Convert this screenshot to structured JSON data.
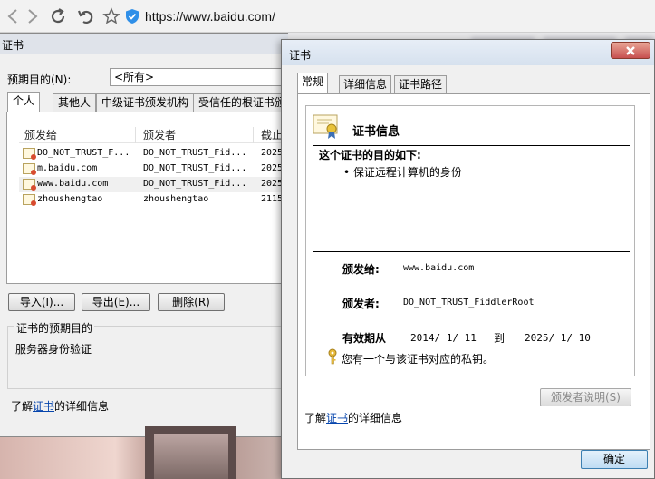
{
  "browser": {
    "url": "https://www.baidu.com/"
  },
  "back_dialog": {
    "title": "证书",
    "purpose_label": "预期目的(N):",
    "purpose_value": "<所有>",
    "tabs": [
      "个人",
      "其他人",
      "中级证书颁发机构",
      "受信任的根证书颁"
    ],
    "columns": [
      "颁发给",
      "颁发者",
      "截止"
    ],
    "rows": [
      {
        "issued_to": "DO_NOT_TRUST_F...",
        "issued_by": "DO_NOT_TRUST_Fid...",
        "expires": "2025"
      },
      {
        "issued_to": "m.baidu.com",
        "issued_by": "DO_NOT_TRUST_Fid...",
        "expires": "2025"
      },
      {
        "issued_to": "www.baidu.com",
        "issued_by": "DO_NOT_TRUST_Fid...",
        "expires": "2025"
      },
      {
        "issued_to": "zhoushengtao",
        "issued_by": "zhoushengtao",
        "expires": "2115"
      }
    ],
    "buttons": {
      "import": "导入(I)...",
      "export": "导出(E)...",
      "remove": "删除(R)"
    },
    "group_title": "证书的预期目的",
    "group_value": "服务器身份验证",
    "learn_prefix": "了解",
    "learn_link": "证书",
    "learn_suffix": "的详细信息"
  },
  "front_dialog": {
    "title": "证书",
    "tabs": [
      "常规",
      "详细信息",
      "证书路径"
    ],
    "info_title": "证书信息",
    "purpose_heading": "这个证书的目的如下:",
    "purpose_item": "• 保证远程计算机的身份",
    "issued_to_label": "颁发给:",
    "issued_to_value": "www.baidu.com",
    "issued_by_label": "颁发者:",
    "issued_by_value": "DO_NOT_TRUST_FiddlerRoot",
    "valid_label": "有效期从",
    "valid_from": "2014/ 1/ 11",
    "valid_to_word": "到",
    "valid_to": "2025/ 1/ 10",
    "key_note": "您有一个与该证书对应的私钥。",
    "issuer_statement_button": "颁发者说明(S)",
    "learn_prefix": "了解",
    "learn_link": "证书",
    "learn_suffix": "的详细信息",
    "ok_button": "确定"
  },
  "colors": {
    "accent": "#0645ad",
    "ok_border": "#3c7fb1",
    "close_red": "#c75050"
  }
}
